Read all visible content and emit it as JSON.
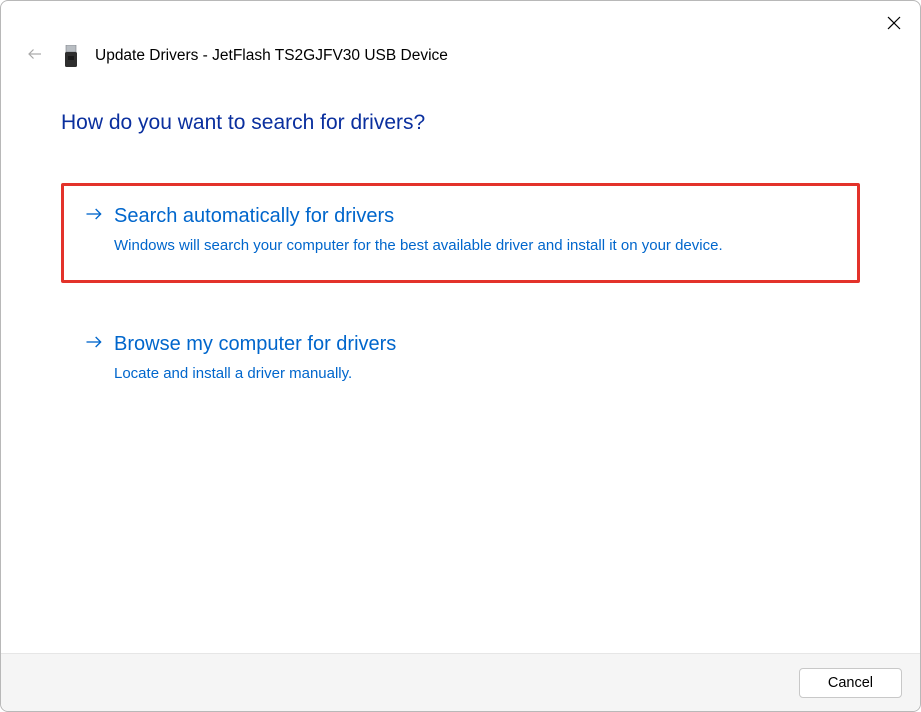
{
  "header": {
    "title": "Update Drivers - JetFlash TS2GJFV30 USB Device"
  },
  "prompt": "How do you want to search for drivers?",
  "options": [
    {
      "title": "Search automatically for drivers",
      "desc": "Windows will search your computer for the best available driver and install it on your device."
    },
    {
      "title": "Browse my computer for drivers",
      "desc": "Locate and install a driver manually."
    }
  ],
  "footer": {
    "cancel": "Cancel"
  }
}
